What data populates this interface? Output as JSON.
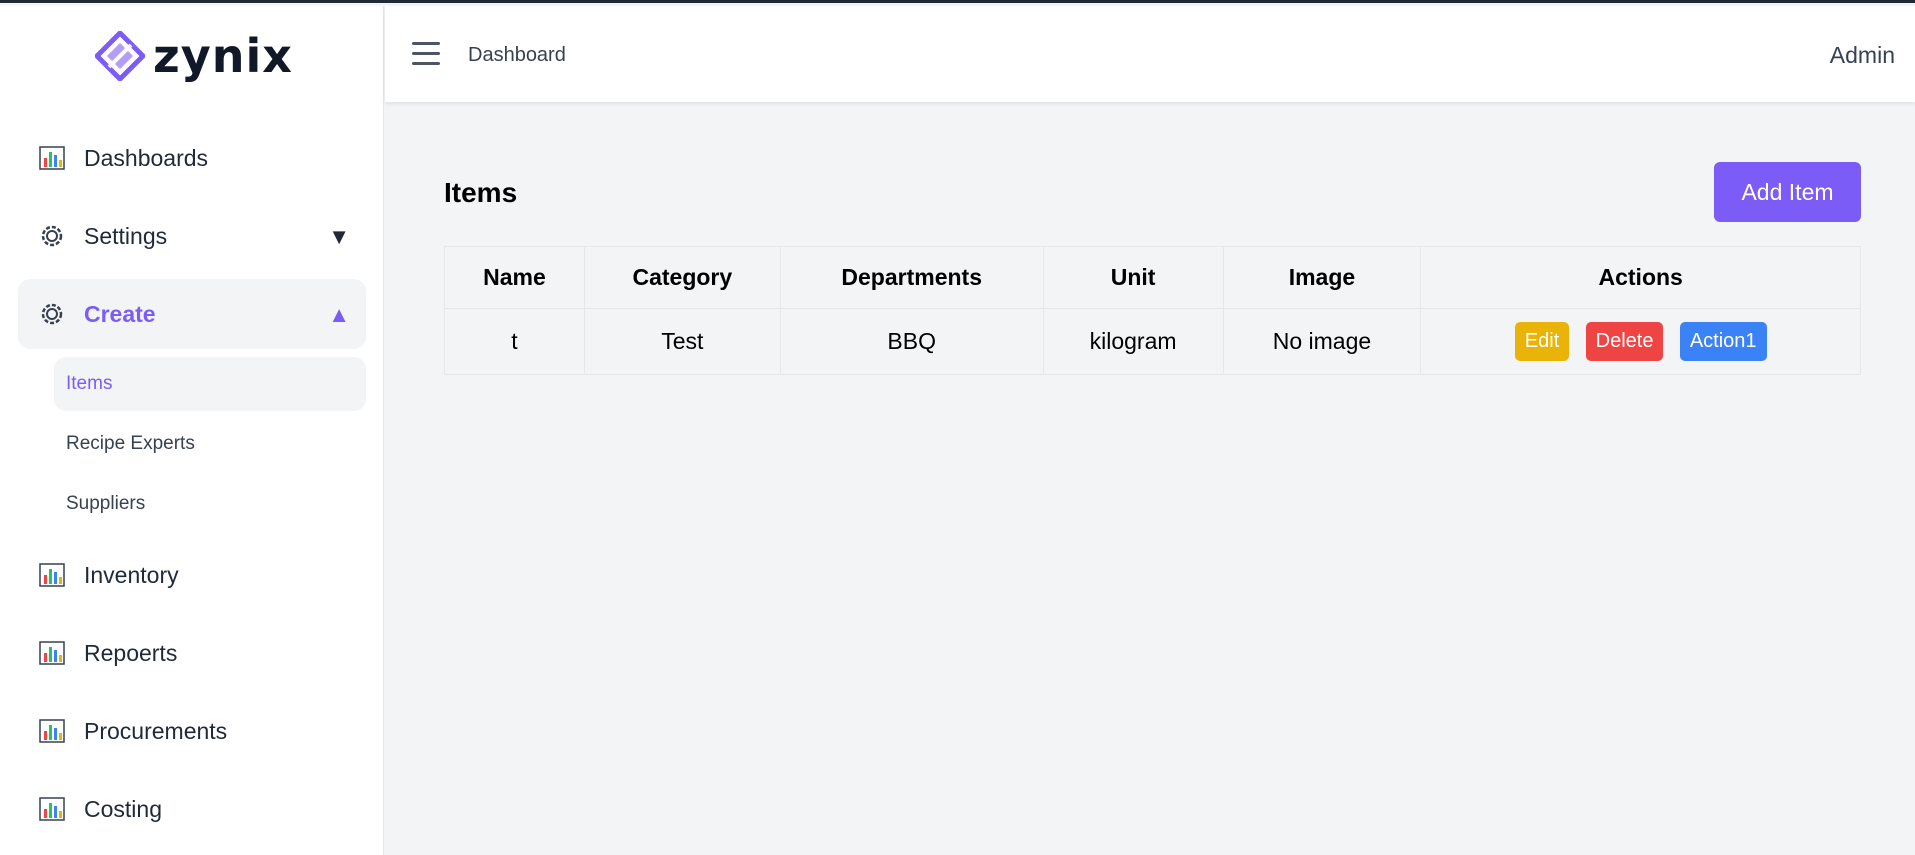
{
  "brand": {
    "name": "zynix",
    "accent": "#7c5cf6"
  },
  "sidebar": {
    "items": [
      {
        "label": "Dashboards",
        "icon": "bar-chart-icon"
      },
      {
        "label": "Settings",
        "icon": "gear-icon",
        "caret": "▼"
      },
      {
        "label": "Create",
        "icon": "gear-icon",
        "caret": "▲",
        "active": true
      },
      {
        "label": "Inventory",
        "icon": "bar-chart-icon"
      },
      {
        "label": "Repoerts",
        "icon": "bar-chart-icon"
      },
      {
        "label": "Procurements",
        "icon": "bar-chart-icon"
      },
      {
        "label": "Costing",
        "icon": "bar-chart-icon"
      }
    ],
    "subitems": [
      {
        "label": "Items",
        "active": true
      },
      {
        "label": "Recipe Experts"
      },
      {
        "label": "Suppliers"
      }
    ]
  },
  "header": {
    "breadcrumb": "Dashboard",
    "user": "Admin"
  },
  "main": {
    "title": "Items",
    "add_button": "Add Item",
    "table": {
      "columns": [
        "Name",
        "Category",
        "Departments",
        "Unit",
        "Image",
        "Actions"
      ],
      "rows": [
        {
          "name": "t",
          "category": "Test",
          "departments": "BBQ",
          "unit": "kilogram",
          "image": "No image"
        }
      ],
      "actions": {
        "edit": "Edit",
        "delete": "Delete",
        "action1": "Action1"
      }
    }
  },
  "colors": {
    "edit": "#eab308",
    "delete": "#ef4444",
    "action1": "#3b82f6"
  }
}
